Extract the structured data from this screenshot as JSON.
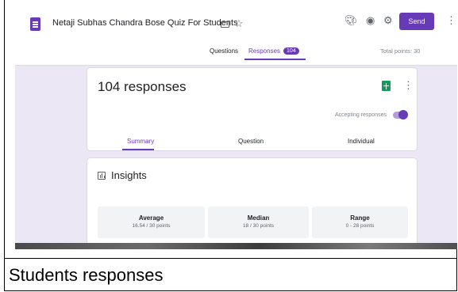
{
  "header": {
    "title": "Netaji Subhas Chandra Bose Quiz For Students",
    "send_label": "Send",
    "tabs": [
      {
        "label": "Questions"
      },
      {
        "label": "Responses",
        "badge": "104"
      }
    ],
    "total_points": "Total points: 30"
  },
  "responses_card": {
    "count_label": "104 responses",
    "accepting_label": "Accepting responses",
    "accepting": true,
    "sub_tabs": [
      "Summary",
      "Question",
      "Individual"
    ]
  },
  "insights": {
    "title": "Insights",
    "stats": [
      {
        "label": "Average",
        "value": "16.54 / 30 points"
      },
      {
        "label": "Median",
        "value": "18 / 30 points"
      },
      {
        "label": "Range",
        "value": "0 - 28 points"
      }
    ]
  },
  "caption": "Students responses",
  "colors": {
    "accent": "#673ab7",
    "sheets_green": "#0f9d58",
    "background": "#ebe7f4"
  }
}
